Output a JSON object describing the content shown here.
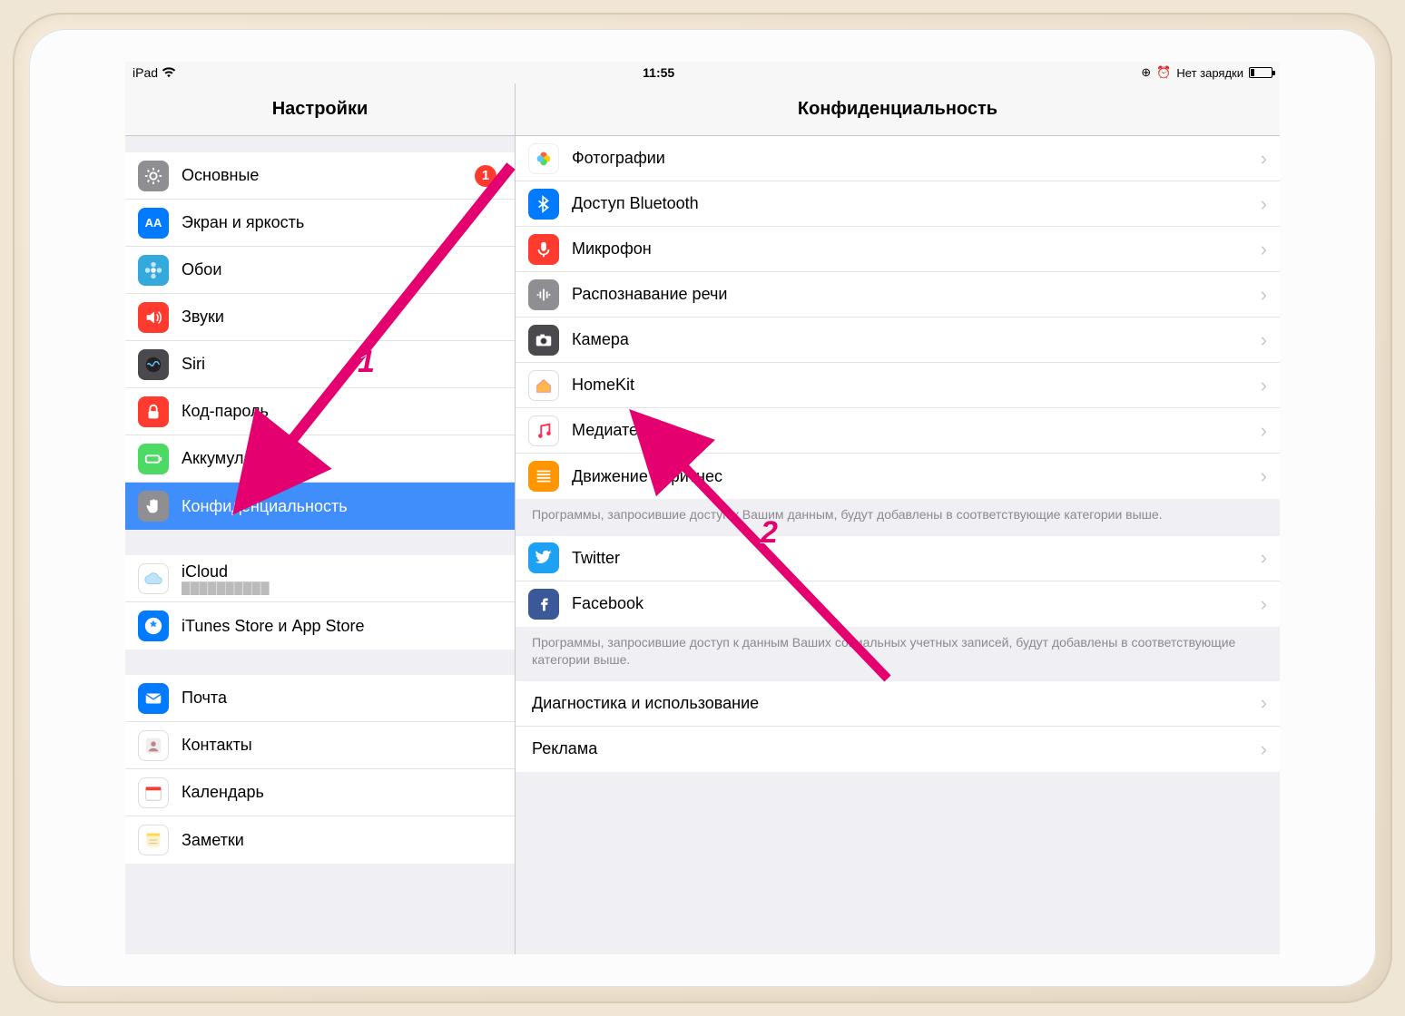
{
  "status": {
    "device": "iPad",
    "time": "11:55",
    "right_text": "Нет зарядки"
  },
  "sidebar": {
    "title": "Настройки",
    "groups": [
      [
        {
          "id": "general",
          "label": "Основные",
          "icon": "gear",
          "bg": "bg-gray",
          "badge": "1"
        },
        {
          "id": "display",
          "label": "Экран и яркость",
          "icon": "AA",
          "bg": "bg-blue"
        },
        {
          "id": "wallpaper",
          "label": "Обои",
          "icon": "flower",
          "bg": "bg-cyan"
        },
        {
          "id": "sounds",
          "label": "Звуки",
          "icon": "speaker",
          "bg": "bg-red"
        },
        {
          "id": "siri",
          "label": "Siri",
          "icon": "siri",
          "bg": "bg-darkgray"
        },
        {
          "id": "passcode",
          "label": "Код-пароль",
          "icon": "lock",
          "bg": "bg-red"
        },
        {
          "id": "battery",
          "label": "Аккумулятор",
          "icon": "battery",
          "bg": "bg-green"
        },
        {
          "id": "privacy",
          "label": "Конфиденциальность",
          "icon": "hand",
          "bg": "bg-gray",
          "selected": true
        }
      ],
      [
        {
          "id": "icloud",
          "label": "iCloud",
          "icon": "cloud",
          "bg": "bg-white",
          "sub": "██████████"
        },
        {
          "id": "itunes",
          "label": "iTunes Store и App Store",
          "icon": "appstore",
          "bg": "bg-blue"
        }
      ],
      [
        {
          "id": "mail",
          "label": "Почта",
          "icon": "mail",
          "bg": "bg-blue"
        },
        {
          "id": "contacts",
          "label": "Контакты",
          "icon": "contacts",
          "bg": "bg-white"
        },
        {
          "id": "calendar",
          "label": "Календарь",
          "icon": "calendar",
          "bg": "bg-white"
        },
        {
          "id": "notes",
          "label": "Заметки",
          "icon": "notes",
          "bg": "bg-white"
        }
      ]
    ]
  },
  "detail": {
    "title": "Конфиденциальность",
    "groups": [
      {
        "rows": [
          {
            "id": "photos",
            "label": "Фотографии",
            "icon": "photos",
            "bg": "bg-multicolor"
          },
          {
            "id": "bt",
            "label": "Доступ Bluetooth",
            "icon": "bt",
            "bg": "bg-blue"
          },
          {
            "id": "mic",
            "label": "Микрофон",
            "icon": "mic",
            "bg": "bg-red"
          },
          {
            "id": "speech",
            "label": "Распознавание речи",
            "icon": "wave",
            "bg": "bg-gray"
          },
          {
            "id": "camera",
            "label": "Камера",
            "icon": "camera",
            "bg": "bg-darkgray"
          },
          {
            "id": "homekit",
            "label": "HomeKit",
            "icon": "home",
            "bg": "bg-white"
          },
          {
            "id": "media",
            "label": "Медиатека",
            "icon": "music",
            "bg": "bg-white"
          },
          {
            "id": "motion",
            "label": "Движение и фитнес",
            "icon": "motion",
            "bg": "bg-orange"
          }
        ],
        "footer": "Программы, запросившие доступ к Вашим данным, будут добавлены в соответствующие категории выше."
      },
      {
        "rows": [
          {
            "id": "twitter",
            "label": "Twitter",
            "icon": "twitter",
            "bg": "bg-tw"
          },
          {
            "id": "facebook",
            "label": "Facebook",
            "icon": "fb",
            "bg": "bg-fb"
          }
        ],
        "footer": "Программы, запросившие доступ к данным Ваших социальных учетных записей, будут добавлены в соответствующие категории выше."
      },
      {
        "rows": [
          {
            "id": "diag",
            "label": "Диагностика и использование"
          },
          {
            "id": "ads",
            "label": "Реклама"
          }
        ]
      }
    ]
  },
  "annotations": {
    "one": "1",
    "two": "2"
  }
}
